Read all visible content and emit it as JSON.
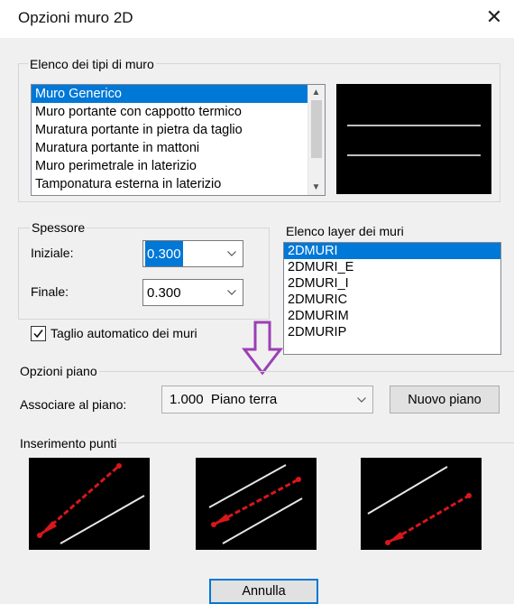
{
  "window": {
    "title": "Opzioni muro 2D",
    "close_glyph": "✕"
  },
  "wall_types": {
    "label": "Elenco dei tipi di muro",
    "items": [
      "Muro Generico",
      "Muro portante con cappotto termico",
      "Muratura portante in pietra da taglio",
      "Muratura portante in mattoni",
      "Muro perimetrale in laterizio",
      "Tamponatura esterna in laterizio"
    ],
    "selected_index": 0
  },
  "thickness": {
    "label": "Spessore",
    "initial_label": "Iniziale:",
    "initial_value": "0.300",
    "final_label": "Finale:",
    "final_value": "0.300"
  },
  "layers": {
    "label": "Elenco layer dei muri",
    "items": [
      "2DMURI",
      "2DMURI_E",
      "2DMURI_I",
      "2DMURIC",
      "2DMURIM",
      "2DMURIP"
    ],
    "selected_index": 0
  },
  "auto_cut": {
    "label": "Taglio automatico dei muri",
    "checked": true
  },
  "floor_options": {
    "label": "Opzioni piano",
    "associate_label": "Associare al piano:",
    "value": "1.000  Piano terra",
    "new_floor_button": "Nuovo piano"
  },
  "insertion": {
    "label": "Inserimento punti",
    "options": [
      "center-insertion-icon",
      "top-insertion-icon",
      "bottom-insertion-icon"
    ]
  },
  "footer": {
    "cancel_button": "Annulla"
  },
  "annotation": {
    "arrow_icon": "down-arrow-icon",
    "color": "#9b3fb5"
  },
  "colors": {
    "accent": "#0078d7",
    "red_line": "#d8171c",
    "white_line": "#e6e6e6"
  }
}
